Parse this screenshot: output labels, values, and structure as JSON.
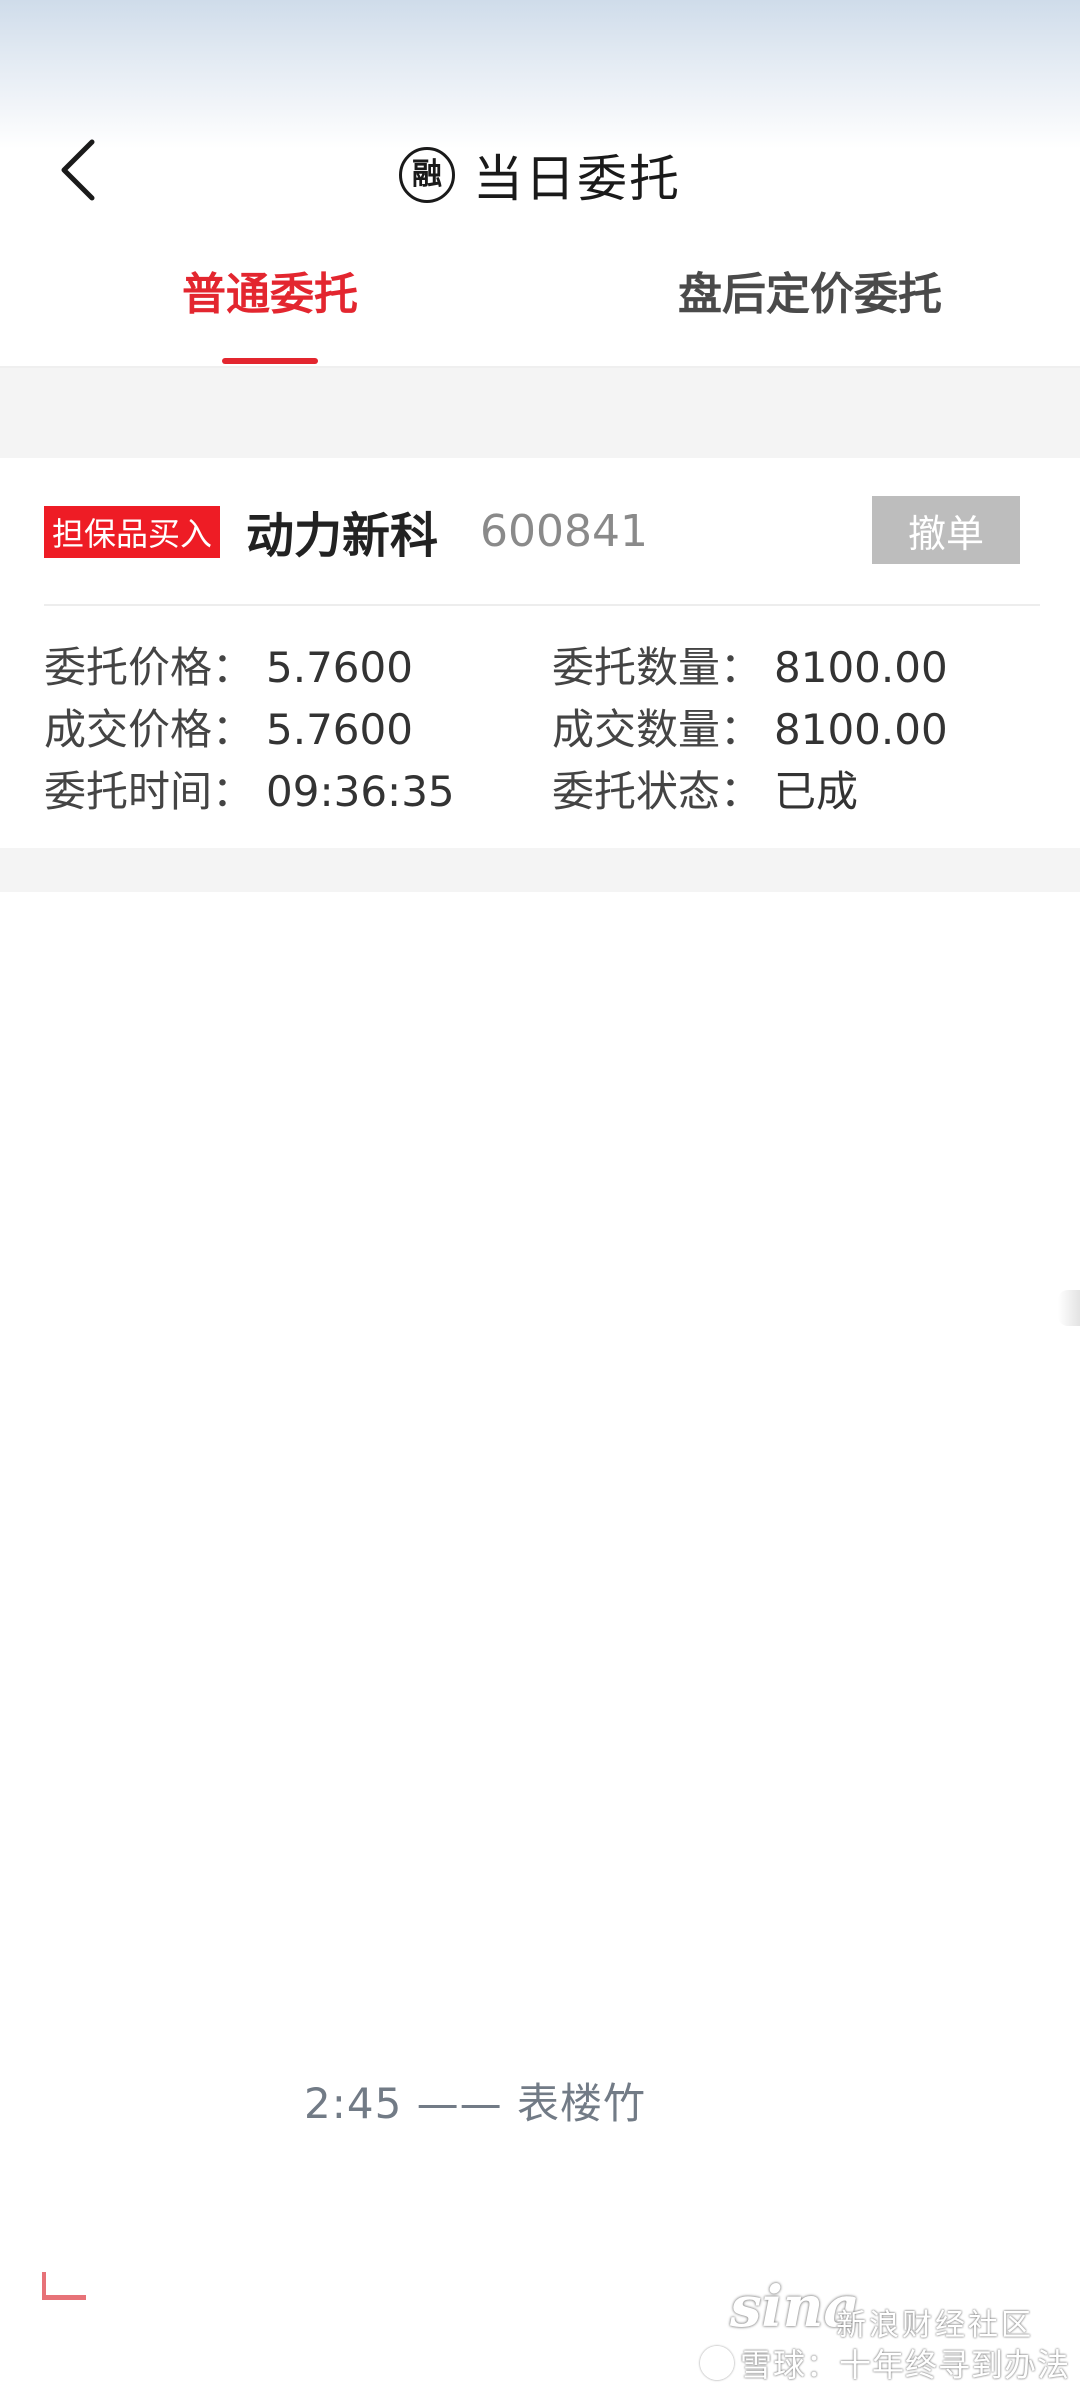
{
  "header": {
    "title": "当日委托",
    "title_badge_char": "融",
    "back_icon": "chevron-left-icon"
  },
  "tabs": [
    {
      "label": "普通委托",
      "active": true
    },
    {
      "label": "盘后定价委托",
      "active": false
    }
  ],
  "order": {
    "type_badge": "担保品买入",
    "stock_name": "动力新科",
    "stock_code": "600841",
    "cancel_label": "撤单",
    "fields": {
      "order_price_label": "委托价格：",
      "order_price": "5.7600",
      "order_qty_label": "委托数量：",
      "order_qty": "8100.00",
      "deal_price_label": "成交价格：",
      "deal_price": "5.7600",
      "deal_qty_label": "成交数量：",
      "deal_qty": "8100.00",
      "order_time_label": "委托时间：",
      "order_time": "09:36:35",
      "status_label": "委托状态：",
      "status": "已成"
    }
  },
  "overlay": {
    "bottom_text": "2:45 —— 表楼竹",
    "sina_logo": "sina",
    "sina_community": "新浪财经社区",
    "xueqiu_line": "雪球：十年终寻到办法"
  },
  "colors": {
    "accent_red": "#e3262f",
    "badge_red": "#ee1c25",
    "cancel_gray": "#bdbdbd",
    "band_gray": "#f4f4f4"
  }
}
